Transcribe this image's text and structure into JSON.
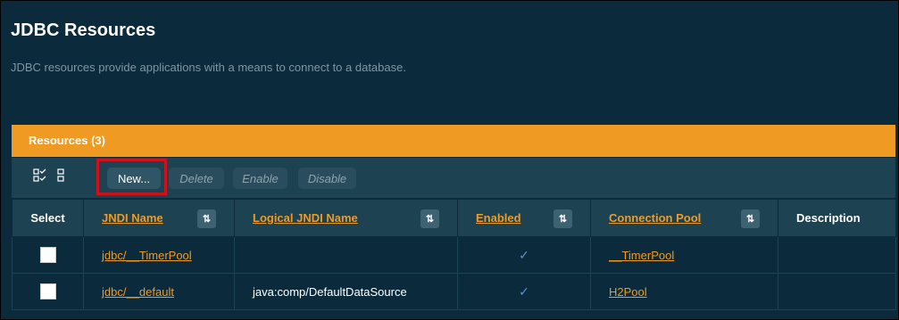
{
  "page": {
    "title": "JDBC Resources",
    "description": "JDBC resources provide applications with a means to connect to a database."
  },
  "panel": {
    "header": "Resources (3)"
  },
  "toolbar": {
    "new_label": "New...",
    "delete_label": "Delete",
    "enable_label": "Enable",
    "disable_label": "Disable"
  },
  "table": {
    "headers": {
      "select": "Select",
      "jndi_name": "JNDI Name",
      "logical_jndi_name": "Logical JNDI Name",
      "enabled": "Enabled",
      "connection_pool": "Connection Pool",
      "description": "Description"
    },
    "rows": [
      {
        "jndi_name": "jdbc/__TimerPool",
        "logical_jndi_name": "",
        "enabled": "✓",
        "connection_pool": "__TimerPool",
        "description": ""
      },
      {
        "jndi_name": "jdbc/__default",
        "logical_jndi_name": "java:comp/DefaultDataSource",
        "enabled": "✓",
        "connection_pool": "H2Pool",
        "description": ""
      }
    ]
  },
  "colors": {
    "background": "#0b2a3b",
    "accent": "#ef9a22",
    "toolbar": "#1d4353",
    "highlight": "#d0101b"
  }
}
